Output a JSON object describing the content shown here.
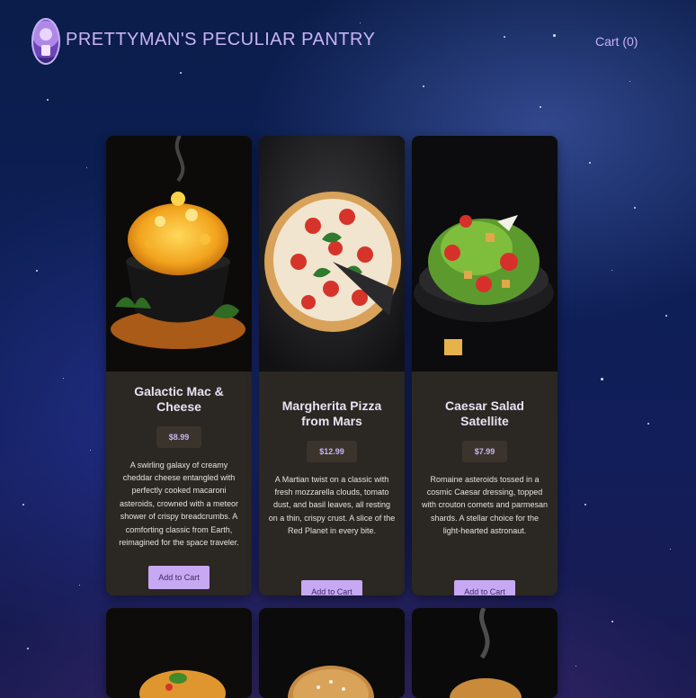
{
  "header": {
    "brand": "PRETTYMAN'S PECULIAR PANTRY",
    "cart_label": "Cart (0)"
  },
  "products": [
    {
      "name": "Galactic Mac & Cheese",
      "price": "$8.99",
      "description": "A swirling galaxy of creamy cheddar cheese entangled with perfectly cooked macaroni asteroids, crowned with a meteor shower of crispy breadcrumbs. A comforting classic from Earth, reimagined for the space traveler.",
      "button": "Add to Cart"
    },
    {
      "name": "Margherita Pizza from Mars",
      "price": "$12.99",
      "description": "A Martian twist on a classic with fresh mozzarella clouds, tomato dust, and basil leaves, all resting on a thin, crispy crust. A slice of the Red Planet in every bite.",
      "button": "Add to Cart"
    },
    {
      "name": "Caesar Salad Satellite",
      "price": "$7.99",
      "description": "Romaine asteroids tossed in a cosmic Caesar dressing, topped with crouton comets and parmesan shards. A stellar choice for the light-hearted astronaut.",
      "button": "Add to Cart"
    }
  ]
}
